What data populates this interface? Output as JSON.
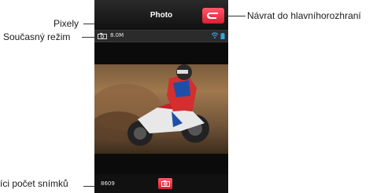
{
  "callouts": {
    "pixels": "Pixely",
    "mode": "Současný režim",
    "back": "Návrat do hlavníhorozhraní",
    "remaining": "íci počet snímků"
  },
  "screen": {
    "title": "Photo",
    "resolution": "8.0M",
    "shots_remaining": "8609"
  },
  "icons": {
    "back": "return-arrow-icon",
    "mode": "camera-icon",
    "wifi": "wifi-icon",
    "battery": "battery-icon",
    "shutter": "camera-icon"
  },
  "colors": {
    "accent": "#e0283c",
    "status_icons": "#3aa0e0"
  }
}
